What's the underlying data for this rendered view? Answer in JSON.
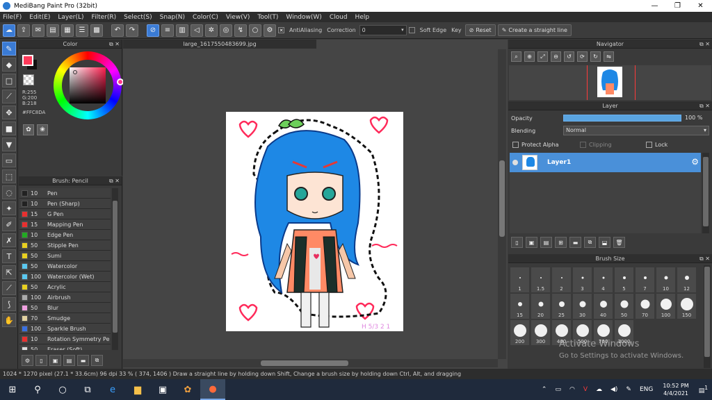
{
  "window": {
    "title": "MediBang Paint Pro (32bit)",
    "minimize": "—",
    "restore": "❐",
    "close": "✕"
  },
  "menu": [
    "File(F)",
    "Edit(E)",
    "Layer(L)",
    "Filter(R)",
    "Select(S)",
    "Snap(N)",
    "Color(C)",
    "View(V)",
    "Tool(T)",
    "Window(W)",
    "Cloud",
    "Help"
  ],
  "toolbar": {
    "antialiasing": "AntiAliasing",
    "correction_label": "Correction",
    "correction_value": "0",
    "soft_edge": "Soft Edge",
    "key": "Key",
    "reset": "Reset",
    "straight_line": "Create a straight line"
  },
  "color": {
    "title": "Color",
    "fg": "#FFC8DA",
    "r": "R:255",
    "g": "G:200",
    "b": "B:218",
    "hex": "#FFC8DA"
  },
  "brush_panel": {
    "title": "Brush: Pencil",
    "items": [
      {
        "size": "10",
        "name": "Pen",
        "color": "#222222"
      },
      {
        "size": "10",
        "name": "Pen (Sharp)",
        "color": "#222222"
      },
      {
        "size": "15",
        "name": "G Pen",
        "color": "#e83030"
      },
      {
        "size": "15",
        "name": "Mapping Pen",
        "color": "#e83030"
      },
      {
        "size": "10",
        "name": "Edge Pen",
        "color": "#22aa22"
      },
      {
        "size": "50",
        "name": "Stipple Pen",
        "color": "#e8d020"
      },
      {
        "size": "50",
        "name": "Sumi",
        "color": "#e8d020"
      },
      {
        "size": "50",
        "name": "Watercolor",
        "color": "#5ac8f0"
      },
      {
        "size": "100",
        "name": "Watercolor (Wet)",
        "color": "#5ac8f0"
      },
      {
        "size": "50",
        "name": "Acrylic",
        "color": "#e8d020"
      },
      {
        "size": "100",
        "name": "Airbrush",
        "color": "#aaaaaa"
      },
      {
        "size": "50",
        "name": "Blur",
        "color": "#f0a0e0"
      },
      {
        "size": "70",
        "name": "Smudge",
        "color": "#e0d0a0"
      },
      {
        "size": "100",
        "name": "Sparkle Brush",
        "color": "#3a70e0"
      },
      {
        "size": "10",
        "name": "Rotation Symmetry Pe",
        "color": "#e83030"
      },
      {
        "size": "50",
        "name": "Eraser (Soft)",
        "color": "#dddddd"
      }
    ]
  },
  "canvas": {
    "tab": "large_1617550483699.jpg"
  },
  "navigator": {
    "title": "Navigator"
  },
  "layer": {
    "title": "Layer",
    "opacity_label": "Opacity",
    "opacity_value": "100 %",
    "opacity_fraction": 1.0,
    "blending_label": "Blending",
    "blending_value": "Normal",
    "protect_alpha": "Protect Alpha",
    "clipping": "Clipping",
    "lock": "Lock",
    "layer_name": "Layer1"
  },
  "brush_size": {
    "title": "Brush Size",
    "sizes": [
      "1",
      "1.5",
      "2",
      "3",
      "4",
      "5",
      "7",
      "10",
      "12",
      "15",
      "20",
      "25",
      "30",
      "40",
      "50",
      "70",
      "100",
      "150",
      "200",
      "300",
      "400",
      "500",
      "700",
      "1000"
    ]
  },
  "activation": {
    "line1": "Activate Windows",
    "line2": "Go to Settings to activate Windows."
  },
  "status": "1024 * 1270 pixel   (27.1 * 33.6cm)   96 dpi   33 %   ( 374, 1406 )   Draw a straight line by holding down Shift, Change a brush size by holding down Ctrl, Alt, and dragging",
  "taskbar": {
    "lang": "ENG",
    "time": "10:52 PM",
    "date": "4/4/2021",
    "notif_count": "1"
  },
  "colors": {
    "accent": "#3a7bd5",
    "layer_selected": "#4a90d9",
    "opacity_bar": "#5aa4e0"
  }
}
